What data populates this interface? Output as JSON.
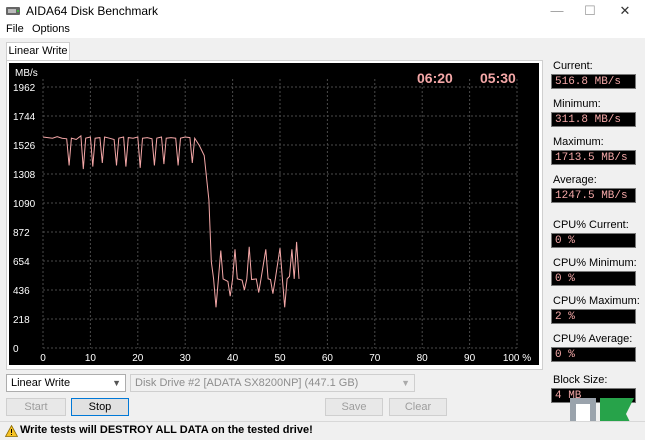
{
  "window": {
    "title": "AIDA64 Disk Benchmark",
    "minimize_glyph": "—",
    "maximize_glyph": "☐",
    "close_glyph": "✕"
  },
  "menu": [
    "File",
    "Options"
  ],
  "tab": "Linear Write",
  "chart": {
    "elapsed": "06:20",
    "remaining": "05:30",
    "yunit": "MB/s",
    "colors": {
      "background": "#000000",
      "grid": "#4a4a4a",
      "line": "#f4a7a7",
      "text": "#ffffff",
      "timer": "#f4a7a7"
    }
  },
  "chart_data": {
    "type": "line",
    "title": "",
    "xlabel": "",
    "ylabel": "MB/s",
    "x_tick_labels": [
      "0",
      "10",
      "20",
      "30",
      "40",
      "50",
      "60",
      "70",
      "80",
      "90",
      "100 %"
    ],
    "y_tick_labels": [
      "1962",
      "1744",
      "1526",
      "1308",
      "1090",
      "872",
      "654",
      "436",
      "218",
      "0"
    ],
    "xlim": [
      0,
      100
    ],
    "ylim": [
      0,
      2180
    ],
    "grid": true,
    "series": [
      {
        "color": "#f4a7a7",
        "points": [
          [
            0,
            1710
          ],
          [
            1,
            1705
          ],
          [
            2,
            1700
          ],
          [
            3,
            1712
          ],
          [
            4,
            1700
          ],
          [
            5,
            1695
          ],
          [
            5.5,
            1480
          ],
          [
            6,
            1700
          ],
          [
            7,
            1690
          ],
          [
            8,
            1720
          ],
          [
            8.5,
            1450
          ],
          [
            9,
            1700
          ],
          [
            10,
            1710
          ],
          [
            10.5,
            1470
          ],
          [
            11,
            1700
          ],
          [
            12,
            1705
          ],
          [
            12.5,
            1500
          ],
          [
            13,
            1710
          ],
          [
            14,
            1700
          ],
          [
            15,
            1690
          ],
          [
            15.5,
            1480
          ],
          [
            16,
            1700
          ],
          [
            17,
            1710
          ],
          [
            17.5,
            1470
          ],
          [
            18,
            1705
          ],
          [
            19,
            1700
          ],
          [
            20,
            1710
          ],
          [
            20.5,
            1460
          ],
          [
            21,
            1700
          ],
          [
            22,
            1705
          ],
          [
            23,
            1695
          ],
          [
            23.5,
            1480
          ],
          [
            24,
            1700
          ],
          [
            25,
            1710
          ],
          [
            25.5,
            1490
          ],
          [
            26,
            1700
          ],
          [
            27,
            1705
          ],
          [
            28,
            1700
          ],
          [
            28.5,
            1480
          ],
          [
            29,
            1700
          ],
          [
            30,
            1710
          ],
          [
            31,
            1705
          ],
          [
            31.5,
            1500
          ],
          [
            32,
            1700
          ],
          [
            33,
            1640
          ],
          [
            34,
            1560
          ],
          [
            35,
            1200
          ],
          [
            35.5,
            700
          ],
          [
            36,
            560
          ],
          [
            36.5,
            330
          ],
          [
            37,
            560
          ],
          [
            37.5,
            790
          ],
          [
            38,
            560
          ],
          [
            39,
            540
          ],
          [
            39.5,
            420
          ],
          [
            40,
            560
          ],
          [
            40.5,
            800
          ],
          [
            41,
            560
          ],
          [
            42,
            550
          ],
          [
            42.5,
            470
          ],
          [
            43,
            560
          ],
          [
            43.5,
            820
          ],
          [
            44,
            555
          ],
          [
            45,
            560
          ],
          [
            45.5,
            450
          ],
          [
            46,
            560
          ],
          [
            47,
            800
          ],
          [
            47.5,
            560
          ],
          [
            48,
            555
          ],
          [
            48.5,
            440
          ],
          [
            49,
            560
          ],
          [
            50,
            810
          ],
          [
            50.5,
            560
          ],
          [
            51,
            330
          ],
          [
            51.5,
            560
          ],
          [
            52,
            580
          ],
          [
            52.5,
            800
          ],
          [
            53,
            560
          ],
          [
            53.5,
            860
          ],
          [
            54,
            560
          ]
        ]
      }
    ]
  },
  "stats": [
    {
      "label": "Current:",
      "value": "516.8 MB/s"
    },
    {
      "label": "Minimum:",
      "value": "311.8 MB/s"
    },
    {
      "label": "Maximum:",
      "value": "1713.5 MB/s"
    },
    {
      "label": "Average:",
      "value": "1247.5 MB/s"
    },
    {
      "label": "CPU% Current:",
      "value": "0 %"
    },
    {
      "label": "CPU% Minimum:",
      "value": "0 %"
    },
    {
      "label": "CPU% Maximum:",
      "value": "2 %"
    },
    {
      "label": "CPU% Average:",
      "value": "0 %"
    },
    {
      "label": "Block Size:",
      "value": "4 MB"
    }
  ],
  "controls": {
    "test_select": "Linear Write",
    "drive_select": "Disk Drive #2  [ADATA SX8200NP]  (447.1 GB)",
    "start": "Start",
    "stop": "Stop",
    "save": "Save",
    "clear": "Clear"
  },
  "status": {
    "warning": "Write tests will DESTROY ALL DATA on the tested drive!"
  }
}
